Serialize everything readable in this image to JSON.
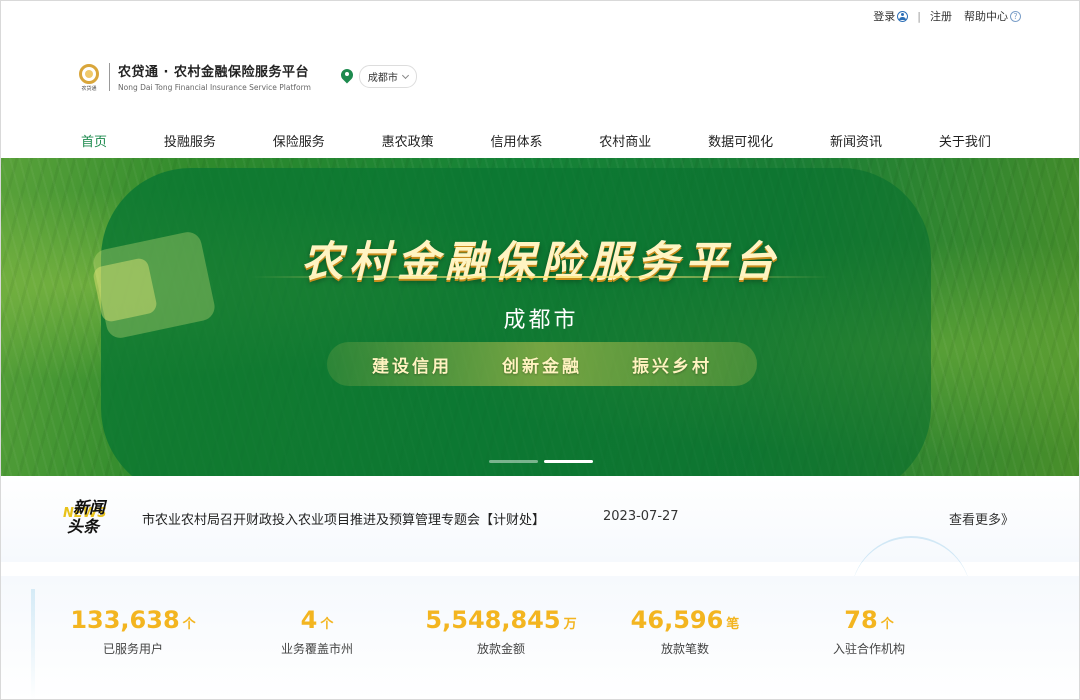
{
  "topbar": {
    "login": "登录",
    "separator": "|",
    "register": "注册",
    "help": "帮助中心"
  },
  "brand": {
    "logo_text": "农贷通",
    "title_cn": "农贷通 · 农村金融保险服务平台",
    "title_en": "Nong Dai Tong Financial Insurance Service Platform",
    "city": "成都市"
  },
  "nav": {
    "items": [
      {
        "label": "首页",
        "active": true
      },
      {
        "label": "投融服务"
      },
      {
        "label": "保险服务"
      },
      {
        "label": "惠农政策"
      },
      {
        "label": "信用体系"
      },
      {
        "label": "农村商业"
      },
      {
        "label": "数据可视化"
      },
      {
        "label": "新闻资讯"
      },
      {
        "label": "关于我们"
      }
    ]
  },
  "hero": {
    "title": "农村金融保险服务平台",
    "city": "成都市",
    "slogans": [
      "建设信用",
      "创新金融",
      "振兴乡村"
    ],
    "slide_count": 2,
    "active_slide": 2
  },
  "news": {
    "badge_cn_1": "新闻",
    "badge_cn_2": "头条",
    "badge_en": "NEWS",
    "headline": "市农业农村局召开财政投入农业项目推进及预算管理专题会【计财处】",
    "date": "2023-07-27",
    "more": "查看更多》"
  },
  "stats": [
    {
      "value": "133,638",
      "unit": "个",
      "label": "已服务用户"
    },
    {
      "value": "4",
      "unit": "个",
      "label": "业务覆盖市州"
    },
    {
      "value": "5,548,845",
      "unit": "万",
      "label": "放款金额"
    },
    {
      "value": "46,596",
      "unit": "笔",
      "label": "放款笔数"
    },
    {
      "value": "78",
      "unit": "个",
      "label": "入驻合作机构"
    }
  ],
  "colors": {
    "brand_green": "#1d8a4e",
    "stat_gold": "#f3b520",
    "link_blue": "#2c6fb7"
  }
}
